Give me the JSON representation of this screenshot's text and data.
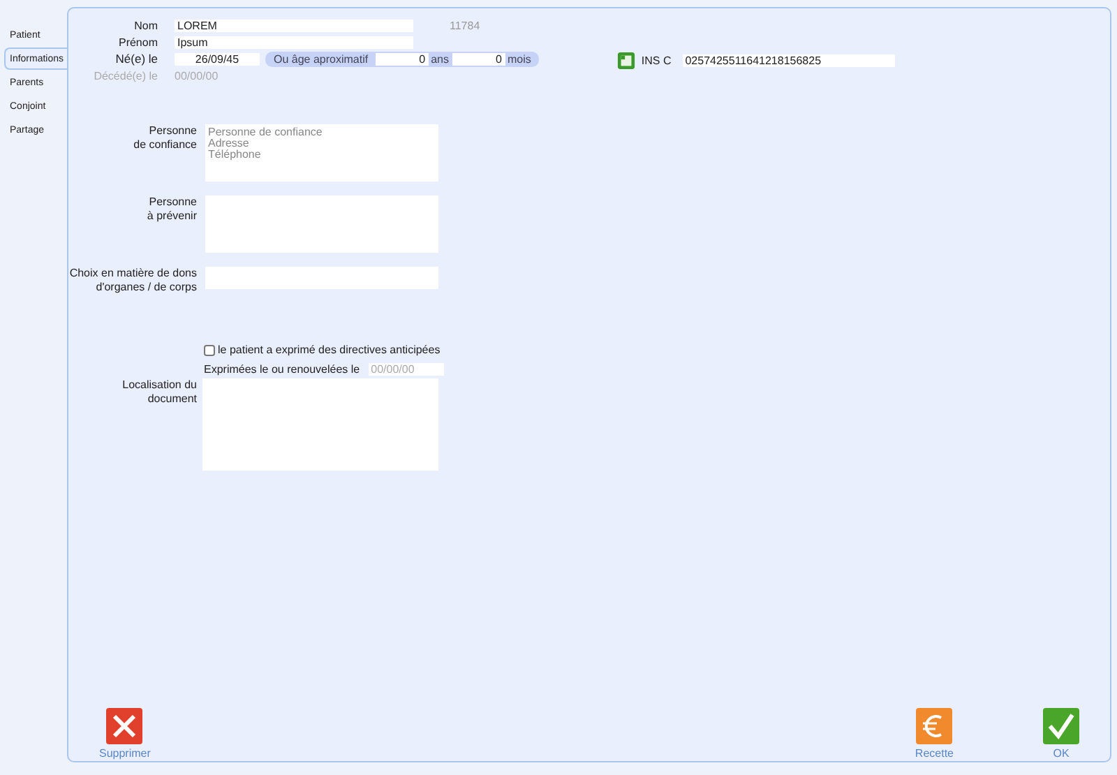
{
  "tabs": [
    {
      "label": "Patient",
      "selected": false
    },
    {
      "label": "Informations",
      "selected": true
    },
    {
      "label": "Parents",
      "selected": false
    },
    {
      "label": "Conjoint",
      "selected": false
    },
    {
      "label": "Partage",
      "selected": false
    }
  ],
  "identity": {
    "nom_label": "Nom",
    "nom": "LOREM",
    "patient_number": "11784",
    "prenom_label": "Prénom",
    "prenom": "Ipsum",
    "birth_label": "Né(e) le",
    "birth_date": "26/09/45",
    "approx_label": "Ou âge aproximatif",
    "approx_years": "0",
    "years_unit": "ans",
    "approx_months": "0",
    "months_unit": "mois",
    "death_label": "Décédé(e) le",
    "death_date": "00/00/00",
    "death_disabled": true,
    "ins_label": "INS C",
    "ins_value": "0257425511641218156825"
  },
  "fields": [
    {
      "label": "Personne\nde confiance",
      "placeholder": "Personne de confiance\nAdresse\nTéléphone",
      "kind": "area"
    },
    {
      "label": "Personne\nà prévenir",
      "kind": "area"
    },
    {
      "label": "Choix en matière de dons\nd'organes / de corps",
      "kind": "line"
    }
  ],
  "directives": {
    "checkbox_label": "le patient a exprimé des directives anticipées",
    "checked": false,
    "date_label": "Exprimées le ou renouvelées le",
    "date_placeholder": "00/00/00",
    "location_label": "Localisation du\ndocument"
  },
  "buttons": [
    {
      "label": "Supprimer",
      "kind": "delete"
    },
    {
      "label": "Recette",
      "kind": "receipt"
    },
    {
      "label": "OK",
      "kind": "ok"
    }
  ]
}
